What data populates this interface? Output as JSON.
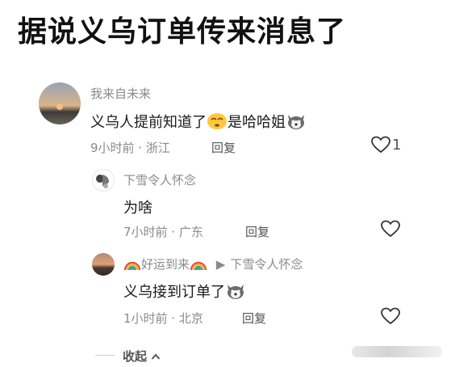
{
  "headline": "据说义乌订单传来消息了",
  "comments": [
    {
      "username": "我来自未来",
      "text": "义乌人提前知道了",
      "text_tail": "是哈哈姐",
      "time_location": "9小时前 · 浙江",
      "reply_label": "回复",
      "like_count": "1"
    },
    {
      "username": "下雪令人怀念",
      "text": "为啥",
      "time_location": "7小时前 · 广东",
      "reply_label": "回复"
    },
    {
      "username": "好运到来",
      "reply_to": "下雪令人怀念",
      "text": "义乌接到订单了",
      "time_location": "1小时前 · 北京",
      "reply_label": "回复"
    }
  ],
  "collapse_label": "收起",
  "icons": [
    "heart-icon",
    "rainbow-icon",
    "husky-emoji-icon",
    "smile-emoji-icon",
    "chevron-up-icon",
    "caret-right-icon"
  ],
  "colors": {
    "meta": "#8a8a8a",
    "text": "#1a1a1a"
  }
}
